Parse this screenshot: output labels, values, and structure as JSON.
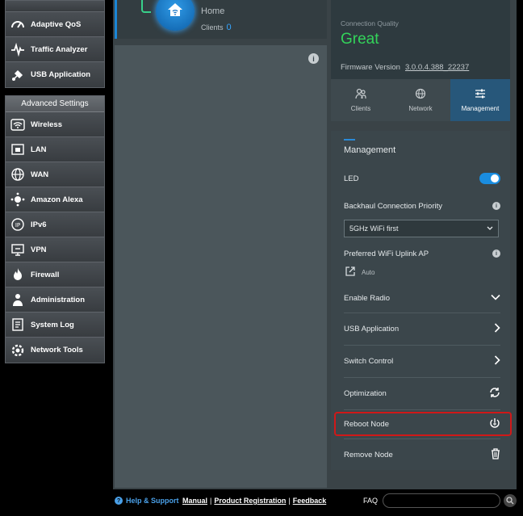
{
  "sidebar": {
    "top_items": [
      {
        "label": "Adaptive QoS",
        "icon": "speedometer-icon"
      },
      {
        "label": "Traffic Analyzer",
        "icon": "pulse-icon"
      },
      {
        "label": "USB Application",
        "icon": "usb-icon"
      }
    ],
    "advanced_header": "Advanced Settings",
    "advanced_items": [
      {
        "label": "Wireless",
        "icon": "wifi-icon"
      },
      {
        "label": "LAN",
        "icon": "lan-icon"
      },
      {
        "label": "WAN",
        "icon": "globe-icon"
      },
      {
        "label": "Amazon Alexa",
        "icon": "alexa-icon"
      },
      {
        "label": "IPv6",
        "icon": "ipv6-icon"
      },
      {
        "label": "VPN",
        "icon": "vpn-icon"
      },
      {
        "label": "Firewall",
        "icon": "firewall-icon"
      },
      {
        "label": "Administration",
        "icon": "admin-icon"
      },
      {
        "label": "System Log",
        "icon": "system-log-icon"
      },
      {
        "label": "Network Tools",
        "icon": "network-tools-icon"
      }
    ]
  },
  "node": {
    "name": "Home",
    "clients_label": "Clients",
    "clients_count": "0"
  },
  "connection": {
    "quality_label": "Connection Quality",
    "quality_value": "Great",
    "firmware_label": "Firmware Version",
    "firmware_value": "3.0.0.4.388_22237"
  },
  "tabs": [
    {
      "label": "Clients",
      "icon": "clients-icon"
    },
    {
      "label": "Network",
      "icon": "network-globe-icon"
    },
    {
      "label": "Management",
      "icon": "sliders-icon",
      "active": true
    }
  ],
  "management": {
    "title": "Management",
    "led_label": "LED",
    "backhaul_label": "Backhaul Connection Priority",
    "backhaul_value": "5GHz WiFi first",
    "uplink_label": "Preferred WiFi Uplink AP",
    "uplink_value": "Auto",
    "enable_radio_label": "Enable Radio",
    "usb_application_label": "USB Application",
    "switch_control_label": "Switch Control",
    "optimization_label": "Optimization",
    "reboot_label": "Reboot Node",
    "remove_label": "Remove Node"
  },
  "footer": {
    "help_label": "Help & Support",
    "manual_label": "Manual",
    "product_registration_label": "Product Registration",
    "feedback_label": "Feedback",
    "separator": "|",
    "faq_label": "FAQ"
  },
  "colors": {
    "accent_blue": "#1a8de0",
    "quality_green": "#33d35a",
    "highlight_red": "#d01818"
  }
}
